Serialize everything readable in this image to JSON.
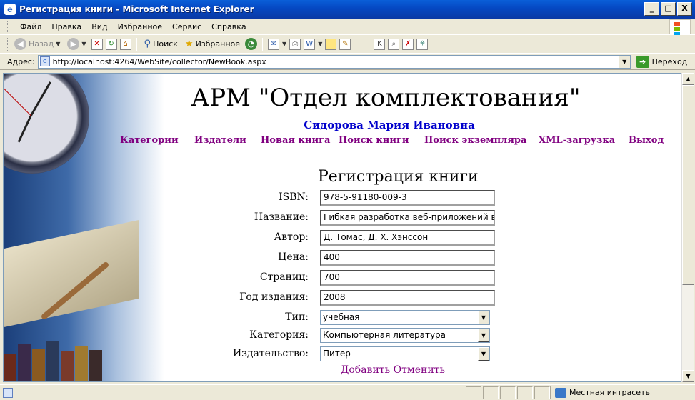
{
  "window": {
    "title": "Регистрация книги - Microsoft Internet Explorer",
    "buttons": {
      "minimize": "_",
      "maximize": "□",
      "close": "X"
    }
  },
  "menu": {
    "items": [
      "Файл",
      "Правка",
      "Вид",
      "Избранное",
      "Сервис",
      "Справка"
    ]
  },
  "toolbar": {
    "back": "Назад",
    "search": "Поиск",
    "favorites": "Избранное"
  },
  "address": {
    "label": "Адрес:",
    "url": "http://localhost:4264/WebSite/collector/NewBook.aspx",
    "go": "Переход"
  },
  "header": {
    "app_title": "АРМ \"Отдел комплектования\"",
    "user_name": "Сидорова Мария Ивановна"
  },
  "nav": {
    "items": [
      "Категории",
      "Издатели",
      "Новая книга",
      "Поиск книги",
      "Поиск экземпляра",
      "XML-загрузка",
      "Выход"
    ]
  },
  "form": {
    "title": "Регистрация книги",
    "fields": [
      {
        "label": "ISBN:",
        "value": "978-5-91180-009-3"
      },
      {
        "label": "Название:",
        "value": "Гибкая разработка веб-приложений в ср"
      },
      {
        "label": "Автор:",
        "value": "Д. Томас, Д. Х. Хэнссон"
      },
      {
        "label": "Цена:",
        "value": "400"
      },
      {
        "label": "Страниц:",
        "value": "700"
      },
      {
        "label": "Год издания:",
        "value": "2008"
      }
    ],
    "selects": [
      {
        "label": "Тип:",
        "value": "учебная"
      },
      {
        "label": "Категория:",
        "value": "Компьютерная литература"
      },
      {
        "label": "Издательство:",
        "value": "Питер"
      }
    ],
    "add": "Добавить",
    "cancel": "Отменить"
  },
  "status": {
    "zone": "Местная интрасеть"
  }
}
